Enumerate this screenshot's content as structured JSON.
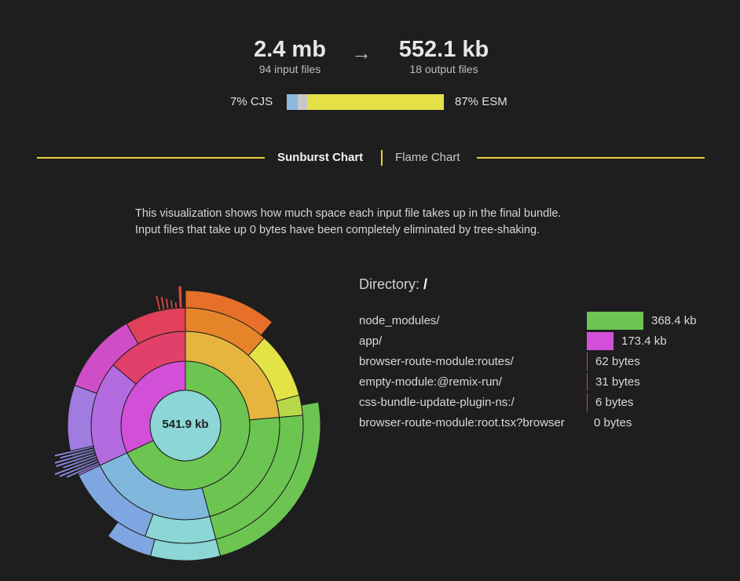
{
  "summary": {
    "input_size": "2.4 mb",
    "input_files": "94 input files",
    "arrow": "→",
    "output_size": "552.1 kb",
    "output_files": "18 output files"
  },
  "format": {
    "cjs_label": "7% CJS",
    "esm_label": "87% ESM",
    "cjs_fraction": 0.07,
    "other_fraction": 0.06,
    "esm_fraction": 0.87,
    "cjs_color": "#8fb8e0",
    "other_color": "#c8c8c8",
    "esm_color": "#e6e047"
  },
  "tabs": {
    "sunburst": "Sunburst Chart",
    "flame": "Flame Chart",
    "accent": "#e6d03a"
  },
  "description": {
    "line1": "This visualization shows how much space each input file takes up in the final bundle.",
    "line2": "Input files that take up 0 bytes have been completely eliminated by tree-shaking."
  },
  "chart": {
    "center_label": "541.9 kb"
  },
  "directory": {
    "label": "Directory:",
    "path": "/",
    "entries": [
      {
        "name": "node_modules/",
        "size": "368.4 kb",
        "fraction": 0.68,
        "color": "#6cc551"
      },
      {
        "name": "app/",
        "size": "173.4 kb",
        "fraction": 0.32,
        "color": "#d24fd8"
      },
      {
        "name": "browser-route-module:routes/",
        "size": "62 bytes",
        "fraction": 0.0001,
        "color": "#e0443e"
      },
      {
        "name": "empty-module:@remix-run/",
        "size": "31 bytes",
        "fraction": 0.0001,
        "color": "#e0443e"
      },
      {
        "name": "css-bundle-update-plugin-ns:/",
        "size": "6 bytes",
        "fraction": 0.0001,
        "color": "#e0443e"
      },
      {
        "name": "browser-route-module:root.tsx?browser",
        "size": "0 bytes",
        "fraction": 0,
        "color": "#e0443e"
      }
    ]
  }
}
